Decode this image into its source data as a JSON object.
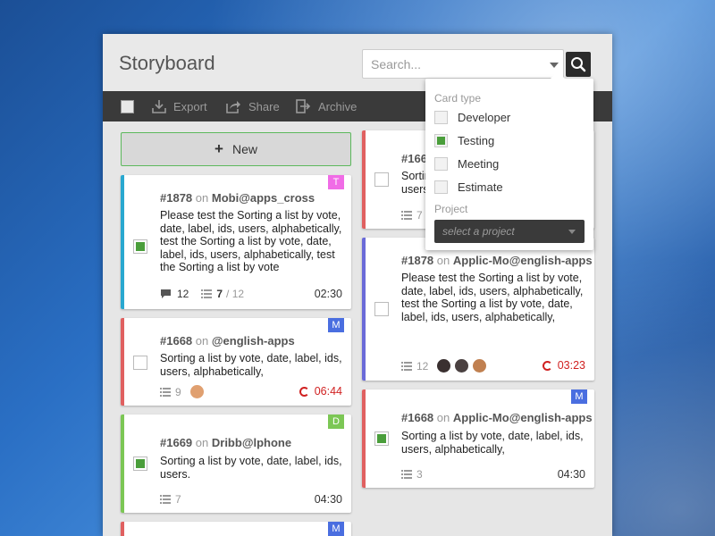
{
  "header": {
    "title": "Storyboard"
  },
  "search": {
    "placeholder": "Search..."
  },
  "toolbar": {
    "export_label": "Export",
    "share_label": "Share",
    "archive_label": "Archive"
  },
  "new_button": {
    "label": "New"
  },
  "colors": {
    "pink": "#f06ce6",
    "blue": "#4a6ee0",
    "green": "#7cc755",
    "cyan": "#29a8d0",
    "red": "#e06060",
    "purple": "#6a6ad8"
  },
  "left_cards": [
    {
      "id": "#1878",
      "on": "on",
      "project": "Mobi@apps_cross",
      "badge": "T",
      "body": "Please test the Sorting a list by vote, date, label, ids, users, alphabetically, test the Sorting a list by vote, date, label, ids, users, alphabetically, test the Sorting a list by vote",
      "comments": "12",
      "tasks_done": "7",
      "tasks_total": "/ 12",
      "time": "02:30"
    },
    {
      "id": "#1668",
      "on": "on",
      "project": "@english-apps",
      "badge": "M",
      "body": "Sorting a list by vote, date, label, ids, users, alphabetically,",
      "tasks": "9",
      "time": "06:44"
    },
    {
      "id": "#1669",
      "on": "on",
      "project": "Dribb@lphone",
      "badge": "D",
      "body": "Sorting a list by vote, date, label, ids, users.",
      "tasks": "7",
      "time": "04:30"
    },
    {
      "badge": "M"
    }
  ],
  "right_cards": [
    {
      "id": "#166",
      "body": "Sortin\nusers,",
      "tasks": "7"
    },
    {
      "id": "#1878",
      "on": "on",
      "project": "Applic-Mo@english-apps",
      "body": "Please test the Sorting a list by vote, date, label, ids, users, alphabetically, test the Sorting a list by vote, date, label, ids, users, alphabetically,",
      "tasks": "12",
      "time": "03:23"
    },
    {
      "id": "#1668",
      "on": "on",
      "project": "Applic-Mo@english-apps",
      "badge": "M",
      "body": "Sorting a list by vote, date, label, ids, users, alphabetically,",
      "tasks": "3",
      "time": "04:30"
    }
  ],
  "dropdown": {
    "card_type_label": "Card type",
    "options": [
      {
        "label": "Developer",
        "checked": false
      },
      {
        "label": "Testing",
        "checked": true
      },
      {
        "label": "Meeting",
        "checked": false
      },
      {
        "label": "Estimate",
        "checked": false
      }
    ],
    "project_label": "Project",
    "project_select": "select a project"
  }
}
